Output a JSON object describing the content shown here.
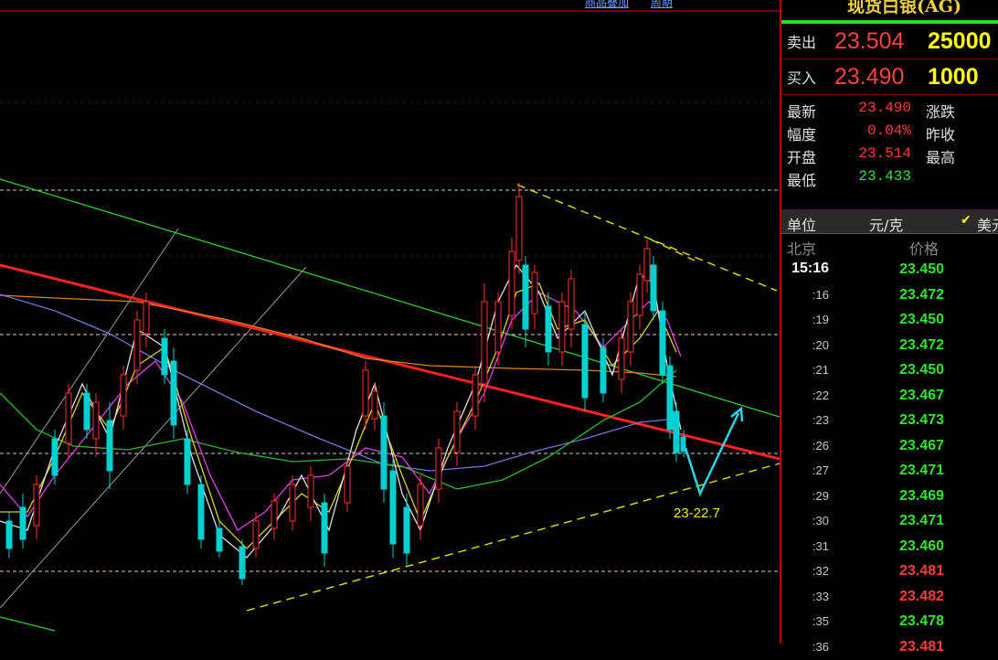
{
  "toolbar": {
    "item1": "商品叠加",
    "item2": "周期"
  },
  "panel": {
    "title": "现货白银(AG)",
    "sell": {
      "label": "卖出",
      "price": "23.504",
      "volume": "25000"
    },
    "buy": {
      "label": "买入",
      "price": "23.490",
      "volume": "1000"
    },
    "stats": [
      {
        "label": "最新",
        "value": "23.490",
        "color": "#ff3b3b",
        "label2": "涨跌"
      },
      {
        "label": "幅度",
        "value": "0.04%",
        "color": "#ff3b3b",
        "label2": "昨收"
      },
      {
        "label": "开盘",
        "value": "23.514",
        "color": "#ff3b3b",
        "label2": "最高"
      },
      {
        "label": "最低",
        "value": "23.433",
        "color": "#2ee82e",
        "label2": ""
      }
    ],
    "unit": {
      "label": "单位",
      "value": "元/克",
      "usd": "美元"
    },
    "ticks_header": {
      "location": "北京",
      "price": "价格"
    },
    "ticks": [
      {
        "time": "15:16",
        "price": "23.450",
        "color": "green"
      },
      {
        "time": ":16",
        "price": "23.472",
        "color": "green"
      },
      {
        "time": ":19",
        "price": "23.450",
        "color": "green"
      },
      {
        "time": ":20",
        "price": "23.472",
        "color": "green"
      },
      {
        "time": ":21",
        "price": "23.450",
        "color": "green"
      },
      {
        "time": ":22",
        "price": "23.467",
        "color": "green"
      },
      {
        "time": ":23",
        "price": "23.473",
        "color": "green"
      },
      {
        "time": ":26",
        "price": "23.467",
        "color": "green"
      },
      {
        "time": ":27",
        "price": "23.471",
        "color": "green"
      },
      {
        "time": ":29",
        "price": "23.469",
        "color": "green"
      },
      {
        "time": ":30",
        "price": "23.471",
        "color": "green"
      },
      {
        "time": ":31",
        "price": "23.460",
        "color": "green"
      },
      {
        "time": ":32",
        "price": "23.481",
        "color": "red"
      },
      {
        "time": ":33",
        "price": "23.482",
        "color": "red"
      },
      {
        "time": ":35",
        "price": "23.478",
        "color": "green"
      },
      {
        "time": ":36",
        "price": "23.481",
        "color": "red"
      }
    ]
  },
  "annotation": "23-22.7"
}
